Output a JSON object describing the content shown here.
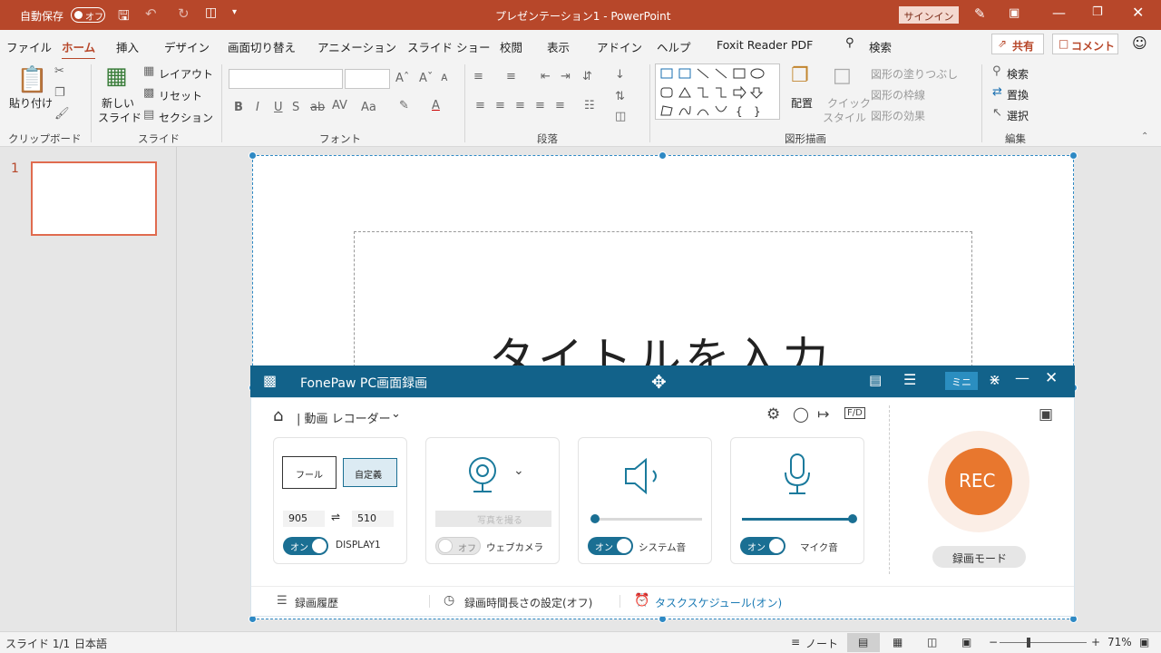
{
  "titlebar": {
    "autosave_label": "自動保存",
    "autosave_state": "オフ",
    "title": "プレゼンテーション1  -  PowerPoint",
    "signin": "サインイン"
  },
  "tabs": [
    "ファイル",
    "ホーム",
    "挿入",
    "デザイン",
    "画面切り替え",
    "アニメーション",
    "スライド ショー",
    "校閲",
    "表示",
    "アドイン",
    "ヘルプ",
    "Foxit Reader PDF"
  ],
  "search_label": "検索",
  "share_label": "共有",
  "comment_label": "コメント",
  "ribbon": {
    "clipboard": {
      "paste": "貼り付け",
      "group": "クリップボード"
    },
    "slides": {
      "new_slide_1": "新しい",
      "new_slide_2": "スライド",
      "layout": "レイアウト",
      "reset": "リセット",
      "section": "セクション",
      "group": "スライド"
    },
    "font": {
      "group": "フォント"
    },
    "paragraph": {
      "group": "段落"
    },
    "drawing": {
      "arrange": "配置",
      "quick_style_1": "クイック",
      "quick_style_2": "スタイル",
      "fill": "図形の塗りつぶし",
      "outline": "図形の枠線",
      "effect": "図形の効果",
      "group": "図形描画"
    },
    "editing": {
      "find": "検索",
      "replace": "置換",
      "select": "選択",
      "group": "編集"
    }
  },
  "thumbnail_number": "1",
  "slide_title": "タイトルを入力",
  "status": {
    "slide": "スライド 1/1",
    "lang": "日本語",
    "notes": "ノート",
    "zoom": "71%"
  },
  "fonepaw": {
    "title": "FonePaw PC画面録画",
    "mini": "ミニ",
    "mode": "| 動画 レコーダー",
    "full": "フール",
    "custom": "自定義",
    "width": "905",
    "height": "510",
    "display": "DISPLAY1",
    "toggle_on": "オン",
    "toggle_off": "オフ",
    "photo": "写真を撮る",
    "webcam": "ウェブカメラ",
    "system_audio": "システム音",
    "mic": "マイク音",
    "rec": "REC",
    "rec_mode": "録画モード",
    "history": "録画履歴",
    "duration": "録画時間長さの設定(オフ)",
    "schedule": "タスクスケジュール(オン)",
    "system_volume": 0.03,
    "mic_volume": 1.0
  },
  "colors": {
    "brand": "#b7472a",
    "fonepaw": "#12628a",
    "rec": "#e8772e"
  }
}
